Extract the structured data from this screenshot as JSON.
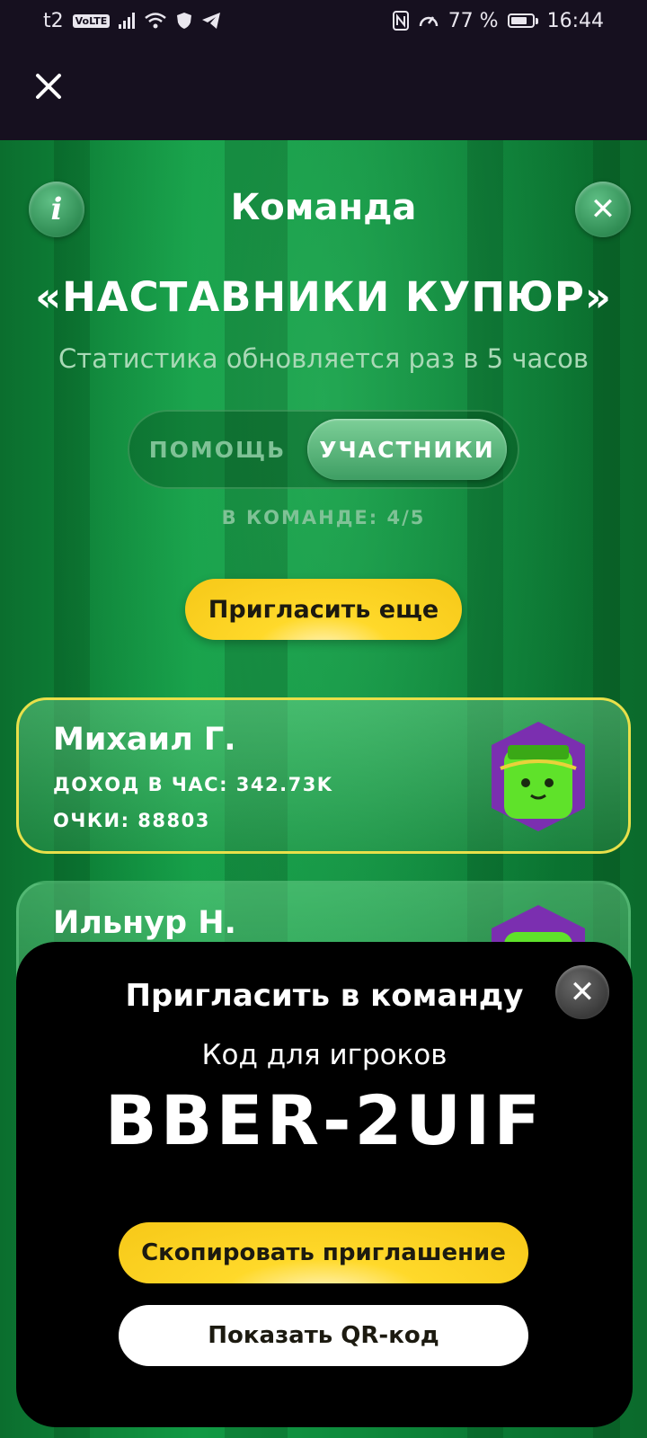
{
  "status_bar": {
    "carrier": "t2",
    "volte": "VoLTE",
    "battery_percent": "77 %",
    "battery_level": 0.77,
    "time": "16:44"
  },
  "top_bar": {
    "close_icon": "close-icon"
  },
  "header": {
    "title": "Команда",
    "info_icon": "info-icon",
    "close_icon": "close-icon",
    "info_symbol": "i",
    "close_symbol": "✕"
  },
  "team": {
    "name": "«НАСТАВНИКИ КУПЮР»",
    "subtitle": "Статистика обновляется раз в 5 часов"
  },
  "segmented": {
    "help": "ПОМОЩЬ",
    "members": "УЧАСТНИКИ",
    "selected": "members"
  },
  "members_count": "В КОМАНДЕ: 4/5",
  "invite_more": "Пригласить еще",
  "members": [
    {
      "name": "Михаил Г.",
      "income": "ДОХОД В ЧАС: 342.73K",
      "points": "ОЧКИ: 88803"
    },
    {
      "name": "Ильнур Н."
    }
  ],
  "invite_sheet": {
    "title": "Пригласить в команду",
    "code_label": "Код для игроков",
    "code": "BBER-2UIF",
    "copy_button": "Скопировать приглашение",
    "qr_button": "Показать QR-код",
    "close_symbol": "✕"
  },
  "colors": {
    "accent_yellow": "#ffd92a",
    "background_green": "#0d8a3a",
    "status_bar": "#16101f"
  }
}
